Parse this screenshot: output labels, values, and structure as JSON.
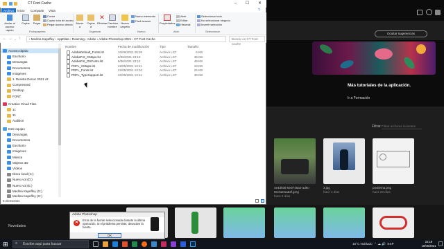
{
  "explorer": {
    "window_title": "CT Font Cache",
    "tabs": [
      "Archivo",
      "Inicio",
      "Compartir",
      "Vista"
    ],
    "ribbon": {
      "pin_label": "Anclar al acceso rápido",
      "copy_label": "Copiar",
      "paste_label": "Pegar",
      "cut_label": "Cortar",
      "copy_path_label": "Copiar ruta de acceso",
      "paste_shortcut_label": "Pegar acceso directo",
      "group_clipboard": "Portapapeles",
      "move_label": "Mover a",
      "copy_to_label": "Copiar a",
      "delete_label": "Eliminar",
      "rename_label": "Cambiar nombre",
      "group_organize": "Organizar",
      "new_folder_label": "Nueva carpeta",
      "new_item_label": "Nuevo elemento",
      "easy_access_label": "Fácil acceso",
      "group_new": "Nuevo",
      "properties_label": "Propiedades",
      "open_label": "Abrir",
      "edit_label": "Editar",
      "history_label": "Historial",
      "group_open": "Abrir",
      "select_all_label": "Seleccionar todo",
      "select_none_label": "No seleccionar ninguno",
      "invert_label": "Invertir selección",
      "group_select": "Seleccionar"
    },
    "address": "› Medina Kapeffey › AppData › Roaming › Adobe › Adobe Photoshop 2021 › CT Font Cache",
    "search_placeholder": "Buscar en CT Font Cache",
    "nav": [
      "Acceso rápido",
      "Escritorio",
      "Descargas",
      "Documentos",
      "Imágenes",
      "1. Revista Donuc 2021 v2",
      "Compressed",
      "Desktop",
      "FONT",
      "Creative Cloud Files",
      "1c",
      "3c",
      "Audition",
      "Este equipo",
      "Descargas",
      "Documentos",
      "Escritorio",
      "Imágenes",
      "Música",
      "Objetos 3D",
      "Vídeos",
      "Disco local (C:)",
      "Nuevo vol (D:)",
      "Nuevo vol (E:)",
      "Medina Kapeffey (G:)",
      "Medina Kapeffey (G:)"
    ],
    "columns": [
      "Nombre",
      "Fecha de modificación",
      "Tipo",
      "Tamaño"
    ],
    "files": [
      {
        "name": "AdobeDefault_Fonts.lst",
        "date": "10/06/2021 20:26",
        "type": "Archivo LST",
        "size": "6 KB"
      },
      {
        "name": "AdobeFnt_CMaps.lst",
        "date": "6/06/2021 23:12",
        "type": "Archivo LST",
        "size": "49 KB"
      },
      {
        "name": "AdobeFnt_OSFonts.lst",
        "date": "6/06/2021 23:12",
        "type": "Archivo LST",
        "size": "49 KB"
      },
      {
        "name": "PDFL_CMaps.lst",
        "date": "22/05/2021 13:11",
        "type": "Archivo LST",
        "size": "13 KB"
      },
      {
        "name": "PDFL_Fonts.lst",
        "date": "22/05/2021 13:10",
        "type": "Archivo LST",
        "size": "24 KB"
      },
      {
        "name": "PDFL_TypeSupport.lst",
        "date": "22/05/2021 13:11",
        "type": "Archivo LST",
        "size": "49 KB"
      }
    ],
    "status": "6 elementos"
  },
  "photoshop": {
    "hide_tips": "Ocultar sugerencias",
    "banner_title": "Más tutoriales de la aplicación.",
    "banner_link": "Ir a Formación",
    "filter_label": "Filtrar",
    "filter_placeholder": "Filtrar archivos recientes",
    "recent": [
      {
        "name": "4e4d936-6e0f-46a2-ad9c-9ec5a01a52f.jpeg",
        "date": "hace 4 días"
      },
      {
        "name": "3.jpg",
        "date": "hace 4 días"
      },
      {
        "name": "postlema.png",
        "date": "hace 20 días"
      }
    ],
    "news_label": "Novedades"
  },
  "dialog": {
    "title": "Adobe Photoshop",
    "message": "Error de la fuente seleccionada durante la última operación. Si el problema persiste, desactive la fuente.",
    "ok": "OK"
  },
  "taskbar": {
    "search_placeholder": "Escribe aquí para buscar",
    "weather": "16°C  Nublado",
    "lang": "ESP",
    "time": "22:19",
    "date": "10/06/2021"
  },
  "colors": {
    "accent": "#1e6fc9",
    "error": "#d9291c",
    "ps_bg": "#1e1e1e"
  }
}
